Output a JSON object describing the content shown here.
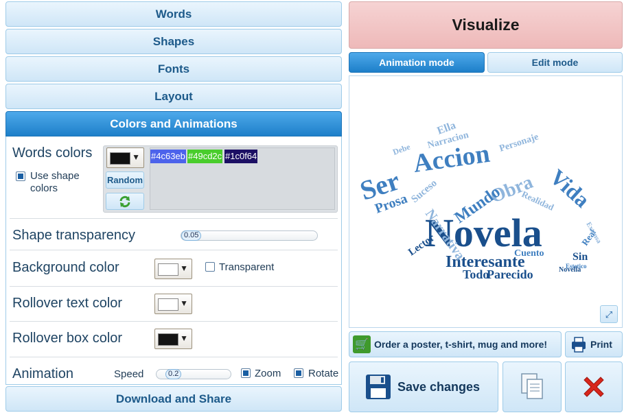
{
  "accordion": {
    "words": "Words",
    "shapes": "Shapes",
    "fonts": "Fonts",
    "layout": "Layout",
    "colors_animations": "Colors and Animations",
    "download_share": "Download and Share"
  },
  "colors": {
    "words_colors_label": "Words colors",
    "use_shape_colors_label": "Use shape colors",
    "random_label": "Random",
    "chips": [
      "#4c63eb",
      "#49cd2c",
      "#1c0f64"
    ],
    "chip_bg": [
      "#4c63eb",
      "#49cd2c",
      "#1c0f64"
    ],
    "shape_transparency_label": "Shape transparency",
    "shape_transparency_value": "0.05",
    "background_color_label": "Background color",
    "transparent_label": "Transparent",
    "rollover_text_color_label": "Rollover text color",
    "rollover_box_color_label": "Rollover box color",
    "animation_label": "Animation",
    "speed_label": "Speed",
    "speed_value": "0.2",
    "zoom_label": "Zoom",
    "rotate_label": "Rotate"
  },
  "right": {
    "visualize": "Visualize",
    "animation_mode": "Animation mode",
    "edit_mode": "Edit mode",
    "order_label": "Order a poster, t-shirt, mug and more!",
    "print_label": "Print",
    "save_changes": "Save changes"
  },
  "cloud_words": [
    "Novela",
    "Ser",
    "Accion",
    "Vida",
    "Interesante",
    "Obra",
    "Mundo",
    "Narrativa",
    "Todo",
    "Parecido",
    "Prosa",
    "Lector",
    "Cuento",
    "Sin",
    "Narracion",
    "Ella",
    "Personaje",
    "Realidad",
    "Suceso",
    "Real",
    "Estetico",
    "Novella",
    "Extensa",
    "Debe"
  ],
  "palette": {
    "accent": "#1d7fc9",
    "visualize_bg": "#f2c4c4",
    "cloud_dark": "#1a4f8c",
    "cloud_mid": "#3f7fc0",
    "cloud_light": "#8fb5dc"
  }
}
